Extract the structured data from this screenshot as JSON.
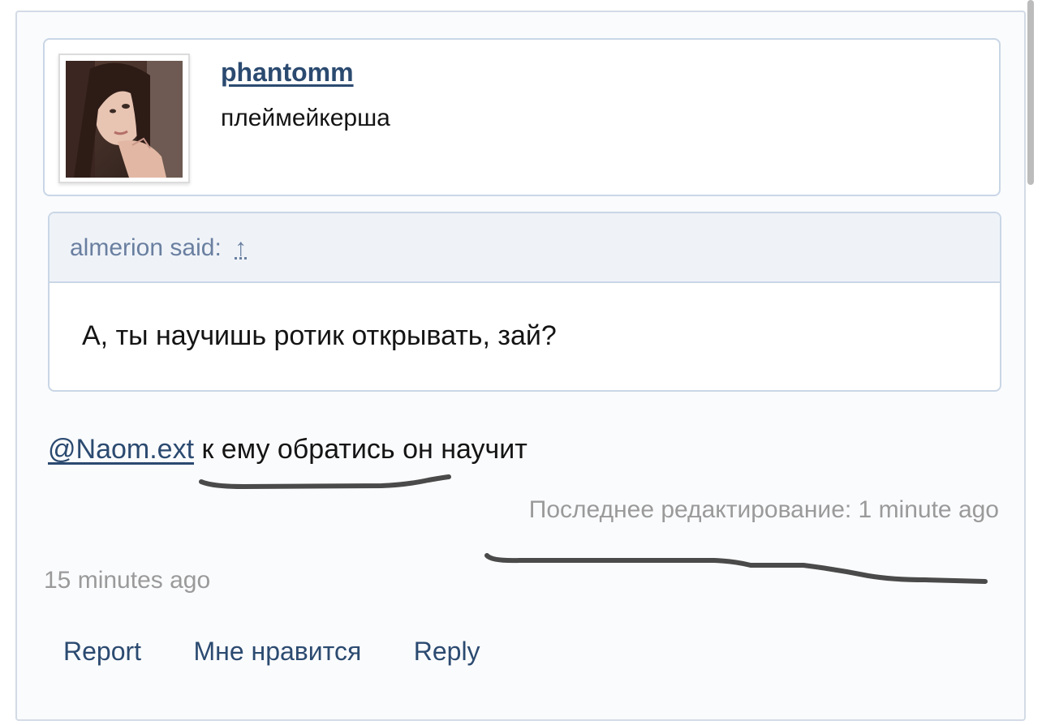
{
  "post": {
    "author": {
      "username": "phantomm",
      "user_title": "плеймейкерша",
      "avatar_icon": "user-avatar-photo"
    },
    "quote": {
      "author": "almerion",
      "said_label": "said:",
      "jump_glyph": "↑",
      "text": "А, ты научишь ротик открывать, зай?"
    },
    "message": {
      "mention": "@Naom.ext",
      "text": " к ему обратись он научит"
    },
    "edited_text": "Последнее редактирование: 1 minute ago",
    "posted_time": "15 minutes ago",
    "actions": {
      "report": "Report",
      "like": "Мне нравится",
      "reply": "Reply"
    }
  },
  "colors": {
    "link": "#2b4a70",
    "muted_text": "#9a9a9a",
    "quote_header_text": "#6a7fa0",
    "border": "#c9d6e6",
    "ink_marks": "#4a4a4a"
  }
}
